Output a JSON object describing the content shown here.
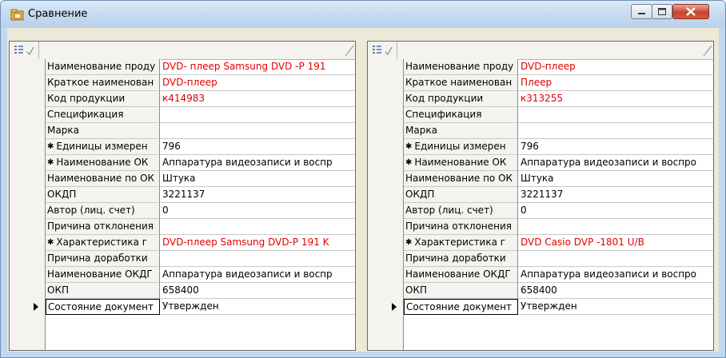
{
  "window": {
    "title": "Сравнение",
    "icon": "folder-icon"
  },
  "colors": {
    "accent": "#e00000",
    "grid_line": "#8a8a8a",
    "header_bg": "#f4f3ef"
  },
  "left": {
    "rows": [
      {
        "label": "Наименование проду",
        "value": "DVD- плеер  Samsung DVD -P 191"
      },
      {
        "label": "Краткое наименован",
        "value": "DVD-плеер"
      },
      {
        "label": "Код продукции",
        "value": "к414983"
      },
      {
        "label": "Спецификация",
        "value": ""
      },
      {
        "label": "Марка",
        "value": ""
      },
      {
        "label": "Единицы измерен",
        "value": "796",
        "expandable": true
      },
      {
        "label": "Наименование ОК",
        "value": "Аппаратура видеозаписи и воспр",
        "expandable": true
      },
      {
        "label": "Наименование по ОК",
        "value": "Штука"
      },
      {
        "label": "ОКДП",
        "value": "3221137"
      },
      {
        "label": "Автор (лиц. счет)",
        "value": "0"
      },
      {
        "label": "Причина отклонения",
        "value": ""
      },
      {
        "label": "Характеристика г",
        "value": "DVD-плеер Samsung DVD-P 191 K",
        "expandable": true
      },
      {
        "label": "Причина доработки",
        "value": ""
      },
      {
        "label": "Наименование ОКДГ",
        "value": "Аппаратура видеозаписи и воспр"
      },
      {
        "label": "ОКП",
        "value": "658400"
      },
      {
        "label": "Состояние документ",
        "value": "Утвержден",
        "current": true
      }
    ]
  },
  "right": {
    "rows": [
      {
        "label": "Наименование проду",
        "value": "DVD-плеер"
      },
      {
        "label": "Краткое наименован",
        "value": "Плеер"
      },
      {
        "label": "Код продукции",
        "value": "к313255"
      },
      {
        "label": "Спецификация",
        "value": ""
      },
      {
        "label": "Марка",
        "value": ""
      },
      {
        "label": "Единицы измерен",
        "value": "796",
        "expandable": true
      },
      {
        "label": "Наименование ОК",
        "value": "Аппаратура видеозаписи и воспро",
        "expandable": true
      },
      {
        "label": "Наименование по ОК",
        "value": "Штука"
      },
      {
        "label": "ОКДП",
        "value": "3221137"
      },
      {
        "label": "Автор (лиц. счет)",
        "value": "0"
      },
      {
        "label": "Причина отклонения",
        "value": ""
      },
      {
        "label": "Характеристика г",
        "value": "DVD Casio DVP -1801 U/B",
        "expandable": true
      },
      {
        "label": "Причина доработки",
        "value": ""
      },
      {
        "label": "Наименование ОКДГ",
        "value": "Аппаратура видеозаписи и воспро"
      },
      {
        "label": "ОКП",
        "value": "658400"
      },
      {
        "label": "Состояние документ",
        "value": "Утвержден",
        "current": true
      }
    ]
  },
  "red_values": {
    "left": [
      0,
      1,
      2,
      11
    ],
    "right": [
      0,
      1,
      2,
      11
    ]
  }
}
